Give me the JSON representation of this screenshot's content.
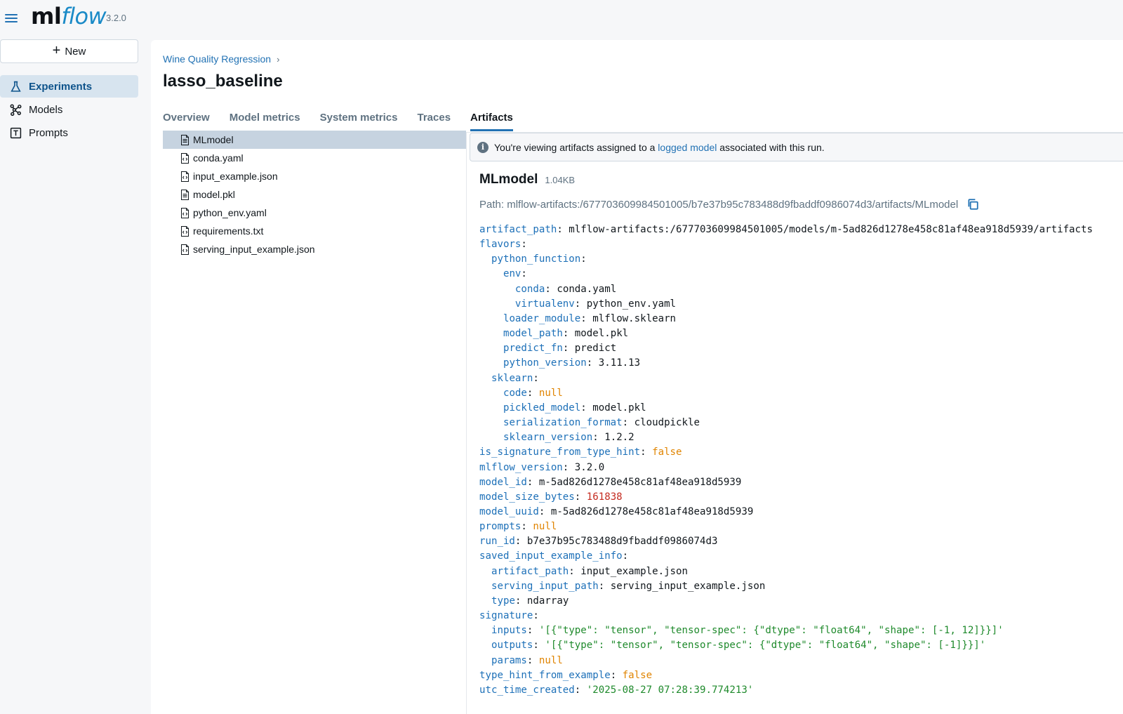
{
  "app": {
    "logo_ml": "ml",
    "logo_flow": "flow",
    "version": "3.2.0"
  },
  "sidebar": {
    "new_label": "New",
    "items": [
      {
        "label": "Experiments",
        "icon": "beaker-icon",
        "active": true
      },
      {
        "label": "Models",
        "icon": "models-icon",
        "active": false
      },
      {
        "label": "Prompts",
        "icon": "prompts-icon",
        "active": false
      }
    ]
  },
  "breadcrumb": {
    "experiment": "Wine Quality Regression",
    "separator": "›"
  },
  "page_title": "lasso_baseline",
  "tabs": [
    "Overview",
    "Model metrics",
    "System metrics",
    "Traces",
    "Artifacts"
  ],
  "active_tab": "Artifacts",
  "files": [
    {
      "name": "MLmodel",
      "selected": true
    },
    {
      "name": "conda.yaml",
      "selected": false
    },
    {
      "name": "input_example.json",
      "selected": false
    },
    {
      "name": "model.pkl",
      "selected": false
    },
    {
      "name": "python_env.yaml",
      "selected": false
    },
    {
      "name": "requirements.txt",
      "selected": false
    },
    {
      "name": "serving_input_example.json",
      "selected": false
    }
  ],
  "banner": {
    "prefix": "You're viewing artifacts assigned to a ",
    "link": "logged model",
    "suffix": " associated with this run."
  },
  "artifact": {
    "name": "MLmodel",
    "size": "1.04KB",
    "path_label": "Path: ",
    "path": "mlflow-artifacts:/677703609984501005/b7e37b95c783488d9fbaddf0986074d3/artifacts/MLmodel"
  },
  "yaml_lines": [
    {
      "indent": 0,
      "key": "artifact_path",
      "value": "mlflow-artifacts:/677703609984501005/models/m-5ad826d1278e458c81af48ea918d5939/artifacts",
      "type": "plain"
    },
    {
      "indent": 0,
      "key": "flavors",
      "value": "",
      "type": "plain"
    },
    {
      "indent": 1,
      "key": "python_function",
      "value": "",
      "type": "plain"
    },
    {
      "indent": 2,
      "key": "env",
      "value": "",
      "type": "plain"
    },
    {
      "indent": 3,
      "key": "conda",
      "value": "conda.yaml",
      "type": "plain"
    },
    {
      "indent": 3,
      "key": "virtualenv",
      "value": "python_env.yaml",
      "type": "plain"
    },
    {
      "indent": 2,
      "key": "loader_module",
      "value": "mlflow.sklearn",
      "type": "plain"
    },
    {
      "indent": 2,
      "key": "model_path",
      "value": "model.pkl",
      "type": "plain"
    },
    {
      "indent": 2,
      "key": "predict_fn",
      "value": "predict",
      "type": "plain"
    },
    {
      "indent": 2,
      "key": "python_version",
      "value": "3.11.13",
      "type": "plain"
    },
    {
      "indent": 1,
      "key": "sklearn",
      "value": "",
      "type": "plain"
    },
    {
      "indent": 2,
      "key": "code",
      "value": "null",
      "type": "null"
    },
    {
      "indent": 2,
      "key": "pickled_model",
      "value": "model.pkl",
      "type": "plain"
    },
    {
      "indent": 2,
      "key": "serialization_format",
      "value": "cloudpickle",
      "type": "plain"
    },
    {
      "indent": 2,
      "key": "sklearn_version",
      "value": "1.2.2",
      "type": "plain"
    },
    {
      "indent": 0,
      "key": "is_signature_from_type_hint",
      "value": "false",
      "type": "null"
    },
    {
      "indent": 0,
      "key": "mlflow_version",
      "value": "3.2.0",
      "type": "plain"
    },
    {
      "indent": 0,
      "key": "model_id",
      "value": "m-5ad826d1278e458c81af48ea918d5939",
      "type": "plain"
    },
    {
      "indent": 0,
      "key": "model_size_bytes",
      "value": "161838",
      "type": "num"
    },
    {
      "indent": 0,
      "key": "model_uuid",
      "value": "m-5ad826d1278e458c81af48ea918d5939",
      "type": "plain"
    },
    {
      "indent": 0,
      "key": "prompts",
      "value": "null",
      "type": "null"
    },
    {
      "indent": 0,
      "key": "run_id",
      "value": "b7e37b95c783488d9fbaddf0986074d3",
      "type": "plain"
    },
    {
      "indent": 0,
      "key": "saved_input_example_info",
      "value": "",
      "type": "plain"
    },
    {
      "indent": 1,
      "key": "artifact_path",
      "value": "input_example.json",
      "type": "plain"
    },
    {
      "indent": 1,
      "key": "serving_input_path",
      "value": "serving_input_example.json",
      "type": "plain"
    },
    {
      "indent": 1,
      "key": "type",
      "value": "ndarray",
      "type": "plain"
    },
    {
      "indent": 0,
      "key": "signature",
      "value": "",
      "type": "plain"
    },
    {
      "indent": 1,
      "key": "inputs",
      "value": "'[{\"type\": \"tensor\", \"tensor-spec\": {\"dtype\": \"float64\", \"shape\": [-1, 12]}}]'",
      "type": "str"
    },
    {
      "indent": 1,
      "key": "outputs",
      "value": "'[{\"type\": \"tensor\", \"tensor-spec\": {\"dtype\": \"float64\", \"shape\": [-1]}}]'",
      "type": "str"
    },
    {
      "indent": 1,
      "key": "params",
      "value": "null",
      "type": "null"
    },
    {
      "indent": 0,
      "key": "type_hint_from_example",
      "value": "false",
      "type": "null"
    },
    {
      "indent": 0,
      "key": "utc_time_created",
      "value": "'2025-08-27 07:28:39.774213'",
      "type": "str"
    }
  ]
}
